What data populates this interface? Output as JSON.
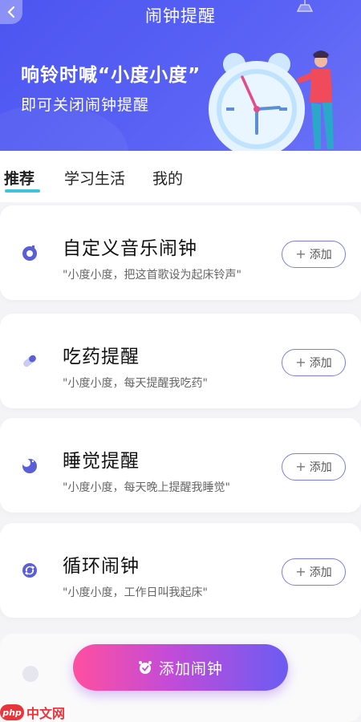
{
  "header": {
    "title": "闹钟提醒",
    "headline": "响铃时喊“小度小度”",
    "subline": "即可关闭闹钟提醒"
  },
  "tabs": [
    {
      "label": "推荐",
      "active": true
    },
    {
      "label": "学习生活",
      "active": false
    },
    {
      "label": "我的",
      "active": false
    }
  ],
  "cards": [
    {
      "title": "自定义音乐闹钟",
      "desc": "\"小度小度，把这首歌设为起床铃声\"",
      "button": "添加",
      "icon": "music-alarm-icon"
    },
    {
      "title": "吃药提醒",
      "desc": "\"小度小度，每天提醒我吃药\"",
      "button": "添加",
      "icon": "pill-icon"
    },
    {
      "title": "睡觉提醒",
      "desc": "\"小度小度，每天晚上提醒我睡觉\"",
      "button": "添加",
      "icon": "moon-icon"
    },
    {
      "title": "循环闹钟",
      "desc": "\"小度小度，工作日叫我起床\"",
      "button": "添加",
      "icon": "repeat-icon"
    }
  ],
  "bottom": {
    "label": "添加闹钟"
  },
  "watermark": {
    "logo": "php",
    "text": "中文网"
  },
  "colors": {
    "banner": "#5a63f5",
    "accent": "#3ec3d9",
    "icon": "#5b5fd6"
  }
}
